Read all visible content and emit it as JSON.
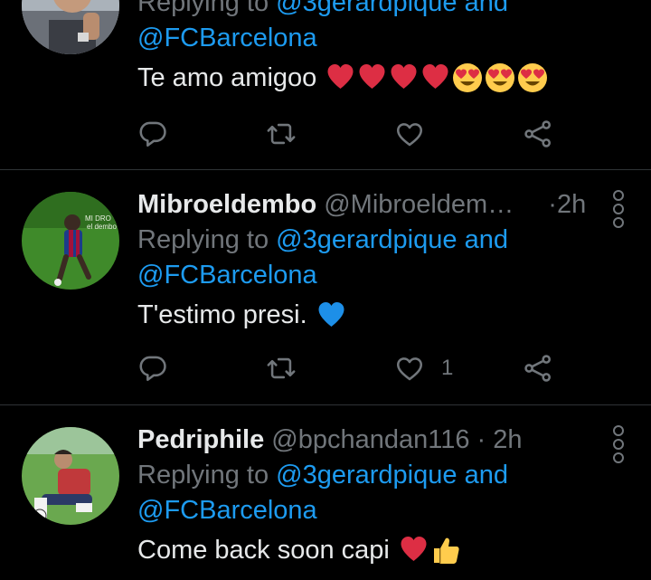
{
  "tweets": [
    {
      "name": "",
      "handle": "",
      "time": "",
      "replying_prefix": "Replying to ",
      "replying_user": "@3gerardpique",
      "replying_and": " and",
      "replying_user2": "@FCBarcelona",
      "text": "Te amo amigoo",
      "emojis": [
        "red-heart",
        "red-heart",
        "red-heart",
        "red-heart",
        "heart-eyes",
        "heart-eyes",
        "heart-eyes"
      ],
      "like_count": ""
    },
    {
      "name": "Mibroeldembo",
      "handle": "@Mibroeldemb…",
      "dot": "·",
      "time": "2h",
      "replying_prefix": "Replying to ",
      "replying_user": "@3gerardpique",
      "replying_and": " and",
      "replying_user2": "@FCBarcelona",
      "text": "T'estimo presi.",
      "emojis": [
        "blue-heart"
      ],
      "like_count": "1",
      "avatar_caption": "MI DRO EL DEMBO"
    },
    {
      "name": "Pedriphile",
      "handle": "@bpchandan116",
      "dot": "·",
      "time": "2h",
      "replying_prefix": "Replying to ",
      "replying_user": "@3gerardpique",
      "replying_and": " and",
      "replying_user2": "@FCBarcelona",
      "text": "Come back soon capi",
      "emojis": [
        "red-heart",
        "thumbs-up"
      ],
      "like_count": ""
    }
  ],
  "colors": {
    "background": "#000000",
    "link": "#1d9bf0",
    "muted": "#71767b",
    "text": "#e7e9ea",
    "divider": "#2f3336"
  },
  "icons": {
    "reply": "reply-icon",
    "retweet": "retweet-icon",
    "like": "like-icon",
    "share": "share-icon",
    "more": "more-options-icon"
  }
}
